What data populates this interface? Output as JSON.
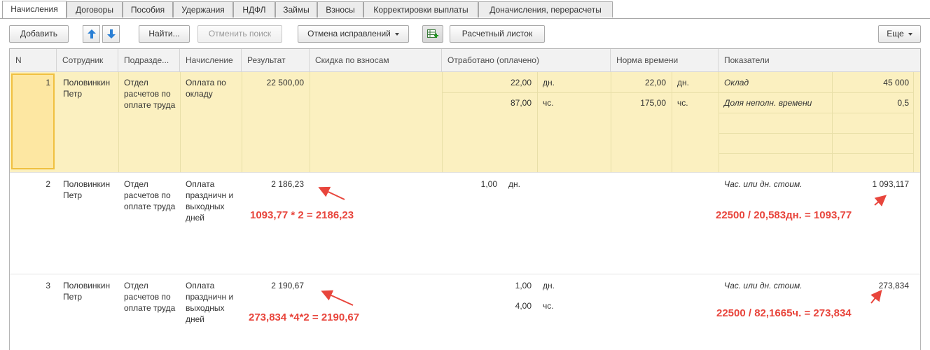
{
  "tabs": [
    "Начисления",
    "Договоры",
    "Пособия",
    "Удержания",
    "НДФЛ",
    "Займы",
    "Взносы",
    "Корректировки выплаты",
    "Доначисления, перерасчеты"
  ],
  "toolbar": {
    "add": "Добавить",
    "find": "Найти...",
    "cancel_search": "Отменить поиск",
    "cancel_corrections": "Отмена исправлений",
    "payslip": "Расчетный листок",
    "more": "Еще"
  },
  "columns": {
    "n": "N",
    "employee": "Сотрудник",
    "department": "Подразде...",
    "accrual": "Начисление",
    "result": "Результат",
    "discount": "Скидка по взносам",
    "worked": "Отработано (оплачено)",
    "norm": "Норма времени",
    "indicators": "Показатели"
  },
  "rows": [
    {
      "n": "1",
      "employee": "Половинкин Петр",
      "department": "Отдел расчетов по оплате труда",
      "accrual": "Оплата по окладу",
      "result": "22 500,00",
      "worked": [
        {
          "value": "22,00",
          "unit": "дн."
        },
        {
          "value": "87,00",
          "unit": "чс."
        }
      ],
      "norm": [
        {
          "value": "22,00",
          "unit": "дн."
        },
        {
          "value": "175,00",
          "unit": "чс."
        }
      ],
      "indicators": [
        {
          "name": "Оклад",
          "value": "45 000"
        },
        {
          "name": "Доля неполн. времени",
          "value": "0,5"
        }
      ]
    },
    {
      "n": "2",
      "employee": "Половинкин Петр",
      "department": "Отдел расчетов по оплате труда",
      "accrual": "Оплата праздничн и выходных дней",
      "result": "2 186,23",
      "worked": [
        {
          "value": "1,00",
          "unit": "дн."
        }
      ],
      "indicators": [
        {
          "name": "Час. или дн. стоим.",
          "value": "1 093,117"
        }
      ]
    },
    {
      "n": "3",
      "employee": "Половинкин Петр",
      "department": "Отдел расчетов по оплате труда",
      "accrual": "Оплата праздничн и выходных дней",
      "result": "2 190,67",
      "worked": [
        {
          "value": "1,00",
          "unit": "дн."
        },
        {
          "value": "4,00",
          "unit": "чс."
        }
      ],
      "indicators": [
        {
          "name": "Час. или дн. стоим.",
          "value": "273,834"
        }
      ]
    }
  ],
  "annotations": {
    "row2_result": "1093,77 * 2 = 2186,23",
    "row2_rate": "22500 / 20,583дн. = 1093,77",
    "row3_result": "273,834 *4*2 = 2190,67",
    "row3_rate": "22500 / 82,1665ч. = 273,834"
  },
  "colors": {
    "selected_row": "#fbf0c0",
    "annotation": "#e8453c",
    "arrow_blue": "#2a7fd4"
  }
}
